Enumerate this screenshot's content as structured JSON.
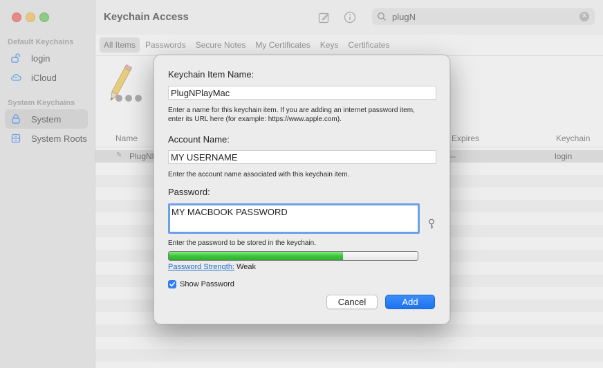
{
  "window": {
    "title": "Keychain Access",
    "search_value": "plugN"
  },
  "sidebar": {
    "default_section": "Default Keychains",
    "default_items": [
      {
        "label": "login",
        "icon": "lock-open-icon"
      },
      {
        "label": "iCloud",
        "icon": "cloud-sync-icon"
      }
    ],
    "system_section": "System Keychains",
    "system_items": [
      {
        "label": "System",
        "icon": "lock-icon",
        "selected": true
      },
      {
        "label": "System Roots",
        "icon": "cabinet-icon"
      }
    ]
  },
  "tabs": [
    "All Items",
    "Passwords",
    "Secure Notes",
    "My Certificates",
    "Keys",
    "Certificates"
  ],
  "list": {
    "columns": {
      "name": "Name",
      "expires": "Expires",
      "keychain": "Keychain"
    },
    "rows": [
      {
        "name": "PlugNP",
        "expires": "--",
        "keychain": "login"
      }
    ]
  },
  "dialog": {
    "item_name_label": "Keychain Item Name:",
    "item_name_value": "PlugNPlayMac",
    "item_name_help": "Enter a name for this keychain item. If you are adding an internet password item, enter its URL here (for example: https://www.apple.com).",
    "account_label": "Account Name:",
    "account_value": "MY USERNAME",
    "account_help": "Enter the account name associated with this keychain item.",
    "password_label": "Password:",
    "password_value": "MY MACBOOK PASSWORD",
    "password_help": "Enter the password to be stored in the keychain.",
    "strength_fraction": 0.7,
    "strength_link": "Password Strength:",
    "strength_value": "Weak",
    "show_password_label": "Show Password",
    "show_password_checked": true,
    "cancel_label": "Cancel",
    "add_label": "Add"
  },
  "colors": {
    "accent": "#2f7ef6",
    "meter_green": "#3ec43e",
    "link": "#1f6fcc"
  }
}
